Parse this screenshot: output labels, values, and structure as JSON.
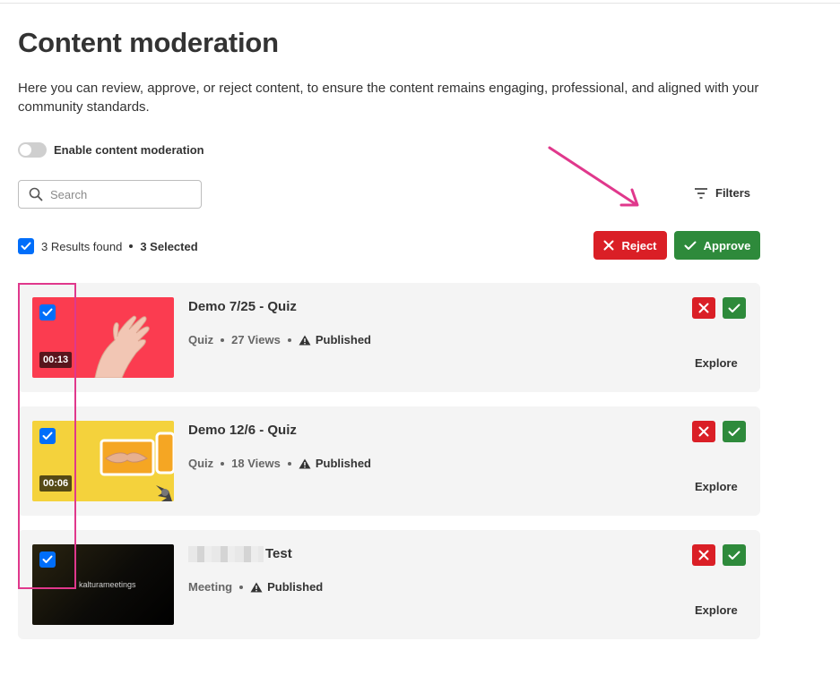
{
  "page": {
    "title": "Content moderation",
    "description": "Here you can review, approve, or reject content, to ensure the content remains engaging, professional, and aligned with your community standards."
  },
  "moderation_toggle": {
    "label": "Enable content moderation",
    "enabled": false
  },
  "search": {
    "placeholder": "Search",
    "value": ""
  },
  "filters": {
    "label": "Filters"
  },
  "results": {
    "found_label": "3 Results found",
    "selected_label": "3 Selected",
    "all_selected": true
  },
  "bulk_actions": {
    "reject_label": "Reject",
    "approve_label": "Approve"
  },
  "colors": {
    "reject": "#da1f26",
    "approve": "#2e8a3b",
    "checkbox": "#006efa",
    "highlight": "#e0388c"
  },
  "entries": [
    {
      "title": "Demo 7/25 - Quiz",
      "type": "Quiz",
      "views": "27 Views",
      "status": "Published",
      "duration": "00:13",
      "explore_label": "Explore",
      "selected": true,
      "thumbnail": "hand-on-red"
    },
    {
      "title": "Demo 12/6 - Quiz",
      "type": "Quiz",
      "views": "18 Views",
      "status": "Published",
      "duration": "00:06",
      "explore_label": "Explore",
      "selected": true,
      "thumbnail": "handshake-on-yellow"
    },
    {
      "title": "Test",
      "type": "Meeting",
      "status": "Published",
      "explore_label": "Explore",
      "selected": true,
      "thumbnail": "kaltura-meetings-dark",
      "thumbnail_text": "kalturameetings"
    }
  ]
}
